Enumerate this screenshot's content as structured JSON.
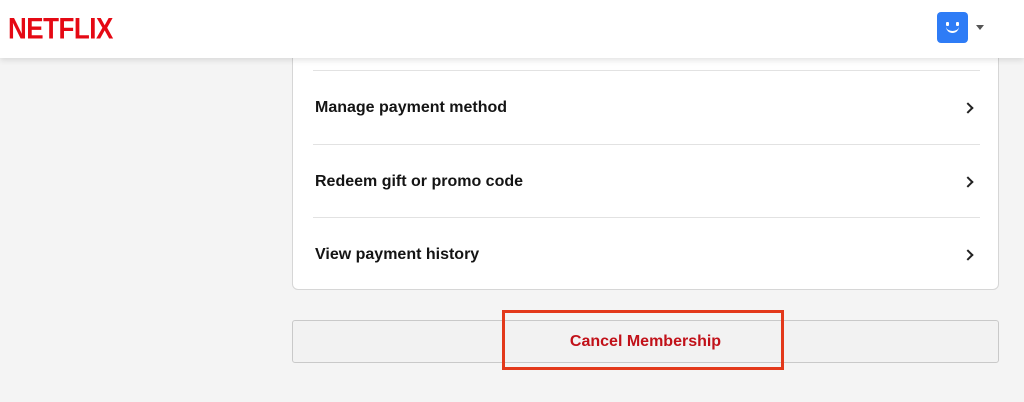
{
  "header": {
    "logo_text": "NETFLIX",
    "brand_color": "#e50914",
    "profile": {
      "avatar_icon": "smiley-face-icon",
      "avatar_color": "#2e7cf6"
    }
  },
  "billing_menu": {
    "items": [
      {
        "label": "Manage payment method"
      },
      {
        "label": "Redeem gift or promo code"
      },
      {
        "label": "View payment history"
      }
    ]
  },
  "cancel": {
    "label": "Cancel Membership",
    "text_color": "#c11119",
    "highlight_color": "#e3391b"
  }
}
